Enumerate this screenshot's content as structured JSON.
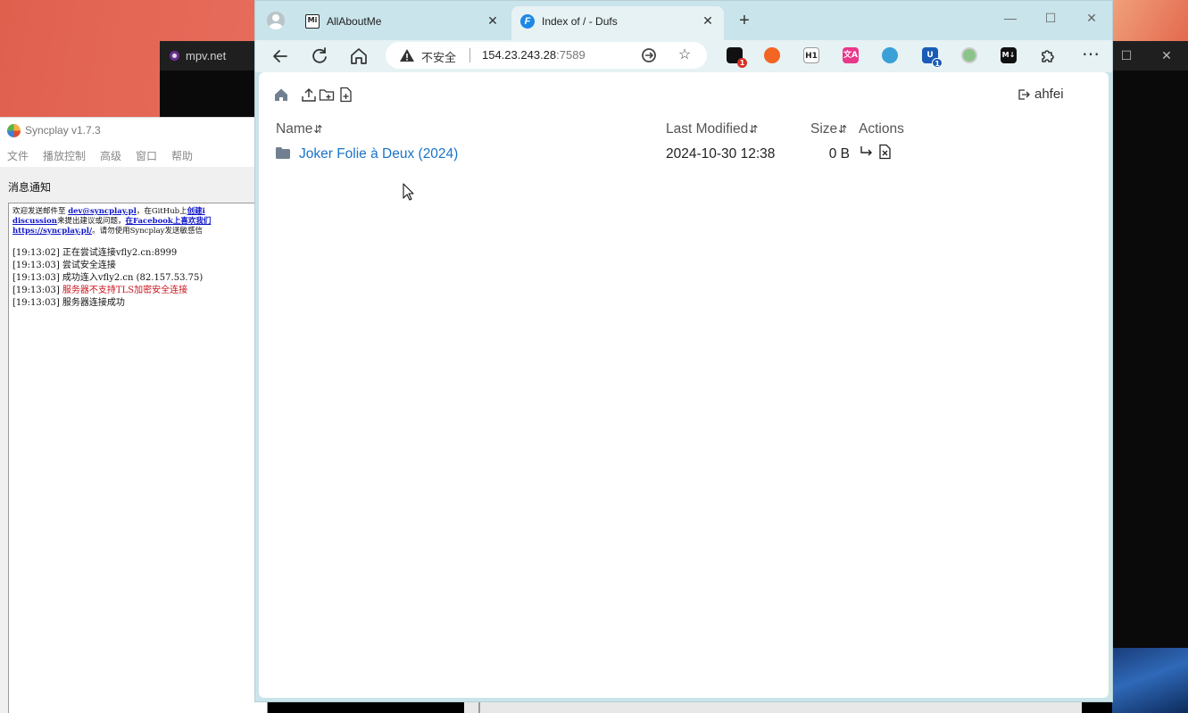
{
  "desktop": {
    "mpv": {
      "title": "mpv.net"
    },
    "syncplay": {
      "title": "Syncplay v1.7.3",
      "menu": [
        "文件",
        "播放控制",
        "高级",
        "窗口",
        "帮助"
      ],
      "section_label": "消息通知",
      "intro": {
        "line1_a": "欢迎发送邮件至 ",
        "line1_link": "dev@syncplay.pl",
        "line1_b": "，在GitHub上",
        "line1_link2": "创建i",
        "line2_link": "discussion",
        "line2_a": "来提出建议或问题，",
        "line2_link2": "在Facebook上喜欢我们",
        "line3_link": "https://syncplay.pl/",
        "line3_a": "。请勿使用Syncplay发送敏感信"
      },
      "log": [
        {
          "time": "[19:13:02]",
          "text": "正在尝试连接vfly2.cn:8999",
          "error": false
        },
        {
          "time": "[19:13:03]",
          "text": "尝试安全连接",
          "error": false
        },
        {
          "time": "[19:13:03]",
          "text": "成功连入vfly2.cn (82.157.53.75)",
          "error": false
        },
        {
          "time": "[19:13:03]",
          "text": "服务器不支持TLS加密安全连接",
          "error": true
        },
        {
          "time": "[19:13:03]",
          "text": "服务器连接成功",
          "error": false
        }
      ]
    }
  },
  "browser": {
    "tabs": [
      {
        "label": "AllAboutMe",
        "icon": "mi-icon",
        "active": false
      },
      {
        "label": "Index of / - Dufs",
        "icon": "dufs-f-icon",
        "active": true
      }
    ],
    "address": {
      "security_label": "不安全",
      "host": "154.23.243.28",
      "port": ":7589"
    },
    "extensions": [
      {
        "name": "ext-black-square-icon",
        "badge": "1",
        "color": "#111111",
        "badge_color": "#d93025"
      },
      {
        "name": "ext-orange-blob-icon",
        "color": "#f26522"
      },
      {
        "name": "ext-h1-icon",
        "label": "H1",
        "color": "#ffffff"
      },
      {
        "name": "ext-translate-icon",
        "label": "文A",
        "color": "#e8388a"
      },
      {
        "name": "ext-globe-icon",
        "color": "#3aa0d8"
      },
      {
        "name": "ext-u-icon",
        "label": "U",
        "badge": "1",
        "color": "#1a5bb8",
        "badge_color": "#1a5bb8"
      },
      {
        "name": "ext-green-circle-icon",
        "color": "#8bc48a"
      },
      {
        "name": "ext-markdown-icon",
        "label": "M↓",
        "color": "#111111"
      }
    ],
    "page": {
      "user": "ahfei",
      "columns": {
        "name": "Name",
        "modified": "Last Modified",
        "size": "Size",
        "actions": "Actions"
      },
      "sort_glyph": "⇵",
      "rows": [
        {
          "name": "Joker Folie à Deux (2024)",
          "modified": "2024-10-30 12:38",
          "size": "0 B"
        }
      ]
    }
  }
}
